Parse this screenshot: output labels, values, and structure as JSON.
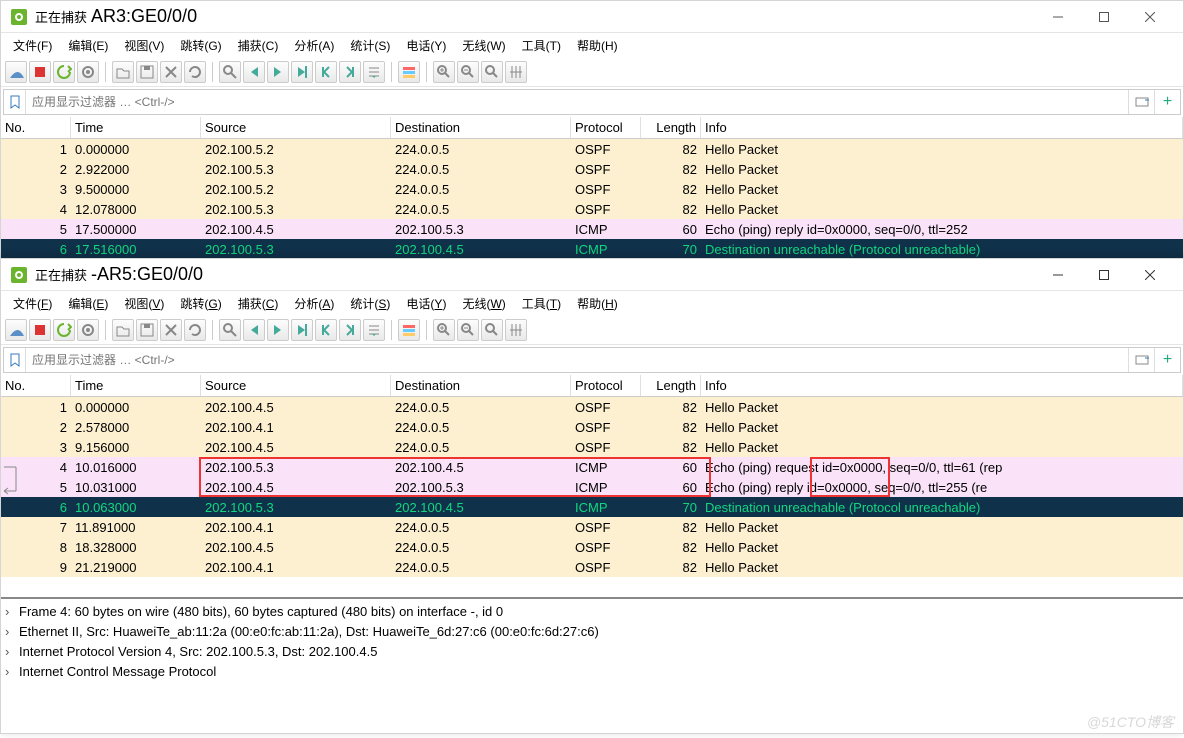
{
  "win1": {
    "cap_prefix": "正在捕获",
    "cap_title": " AR3:GE0/0/0",
    "menu": [
      "文件(F)",
      "编辑(E)",
      "视图(V)",
      "跳转(G)",
      "捕获(C)",
      "分析(A)",
      "统计(S)",
      "电话(Y)",
      "无线(W)",
      "工具(T)",
      "帮助(H)"
    ],
    "filter_ph": "应用显示过滤器 … <Ctrl-/>",
    "cols": {
      "no": "No.",
      "time": "Time",
      "src": "Source",
      "dst": "Destination",
      "proto": "Protocol",
      "len": "Length",
      "info": "Info"
    },
    "rows": [
      {
        "no": "1",
        "time": "0.000000",
        "src": "202.100.5.2",
        "dst": "224.0.0.5",
        "proto": "OSPF",
        "len": "82",
        "info": "Hello Packet",
        "cls": "r-ospf"
      },
      {
        "no": "2",
        "time": "2.922000",
        "src": "202.100.5.3",
        "dst": "224.0.0.5",
        "proto": "OSPF",
        "len": "82",
        "info": "Hello Packet",
        "cls": "r-ospf"
      },
      {
        "no": "3",
        "time": "9.500000",
        "src": "202.100.5.2",
        "dst": "224.0.0.5",
        "proto": "OSPF",
        "len": "82",
        "info": "Hello Packet",
        "cls": "r-ospf"
      },
      {
        "no": "4",
        "time": "12.078000",
        "src": "202.100.5.3",
        "dst": "224.0.0.5",
        "proto": "OSPF",
        "len": "82",
        "info": "Hello Packet",
        "cls": "r-ospf"
      },
      {
        "no": "5",
        "time": "17.500000",
        "src": "202.100.4.5",
        "dst": "202.100.5.3",
        "proto": "ICMP",
        "len": "60",
        "info": "Echo (ping) reply    id=0x0000, seq=0/0, ttl=252",
        "cls": "r-icmp"
      },
      {
        "no": "6",
        "time": "17.516000",
        "src": "202.100.5.3",
        "dst": "202.100.4.5",
        "proto": "ICMP",
        "len": "70",
        "info": "Destination unreachable (Protocol unreachable)",
        "cls": "r-sel"
      }
    ]
  },
  "win2": {
    "cap_prefix": "正在捕获",
    "cap_title": " -AR5:GE0/0/0",
    "menu": [
      "文件(F)",
      "编辑(E)",
      "视图(V)",
      "跳转(G)",
      "捕获(C)",
      "分析(A)",
      "统计(S)",
      "电话(Y)",
      "无线(W)",
      "工具(T)",
      "帮助(H)"
    ],
    "filter_ph": "应用显示过滤器 … <Ctrl-/>",
    "cols": {
      "no": "No.",
      "time": "Time",
      "src": "Source",
      "dst": "Destination",
      "proto": "Protocol",
      "len": "Length",
      "info": "Info"
    },
    "rows": [
      {
        "no": "1",
        "time": "0.000000",
        "src": "202.100.4.5",
        "dst": "224.0.0.5",
        "proto": "OSPF",
        "len": "82",
        "info": "Hello Packet",
        "cls": "r-ospf"
      },
      {
        "no": "2",
        "time": "2.578000",
        "src": "202.100.4.1",
        "dst": "224.0.0.5",
        "proto": "OSPF",
        "len": "82",
        "info": "Hello Packet",
        "cls": "r-ospf"
      },
      {
        "no": "3",
        "time": "9.156000",
        "src": "202.100.4.5",
        "dst": "224.0.0.5",
        "proto": "OSPF",
        "len": "82",
        "info": "Hello Packet",
        "cls": "r-ospf"
      },
      {
        "no": "4",
        "time": "10.016000",
        "src": "202.100.5.3",
        "dst": "202.100.4.5",
        "proto": "ICMP",
        "len": "60",
        "info": "Echo (ping) request  id=0x0000, seq=0/0, ttl=61 (rep",
        "cls": "r-icmp"
      },
      {
        "no": "5",
        "time": "10.031000",
        "src": "202.100.4.5",
        "dst": "202.100.5.3",
        "proto": "ICMP",
        "len": "60",
        "info": "Echo (ping) reply    id=0x0000, seq=0/0, ttl=255 (re",
        "cls": "r-icmp"
      },
      {
        "no": "6",
        "time": "10.063000",
        "src": "202.100.5.3",
        "dst": "202.100.4.5",
        "proto": "ICMP",
        "len": "70",
        "info": "Destination unreachable (Protocol unreachable)",
        "cls": "r-sel"
      },
      {
        "no": "7",
        "time": "11.891000",
        "src": "202.100.4.1",
        "dst": "224.0.0.5",
        "proto": "OSPF",
        "len": "82",
        "info": "Hello Packet",
        "cls": "r-ospf"
      },
      {
        "no": "8",
        "time": "18.328000",
        "src": "202.100.4.5",
        "dst": "224.0.0.5",
        "proto": "OSPF",
        "len": "82",
        "info": "Hello Packet",
        "cls": "r-ospf"
      },
      {
        "no": "9",
        "time": "21.219000",
        "src": "202.100.4.1",
        "dst": "224.0.0.5",
        "proto": "OSPF",
        "len": "82",
        "info": "Hello Packet",
        "cls": "r-ospf"
      }
    ],
    "details": [
      "Frame 4: 60 bytes on wire (480 bits), 60 bytes captured (480 bits) on interface -, id 0",
      "Ethernet II, Src: HuaweiTe_ab:11:2a (00:e0:fc:ab:11:2a), Dst: HuaweiTe_6d:27:c6 (00:e0:fc:6d:27:c6)",
      "Internet Protocol Version 4, Src: 202.100.5.3, Dst: 202.100.4.5",
      "Internet Control Message Protocol"
    ]
  },
  "watermark": "@51CTO博客",
  "hl_words": {
    "request": "request",
    "reply": "reply"
  }
}
